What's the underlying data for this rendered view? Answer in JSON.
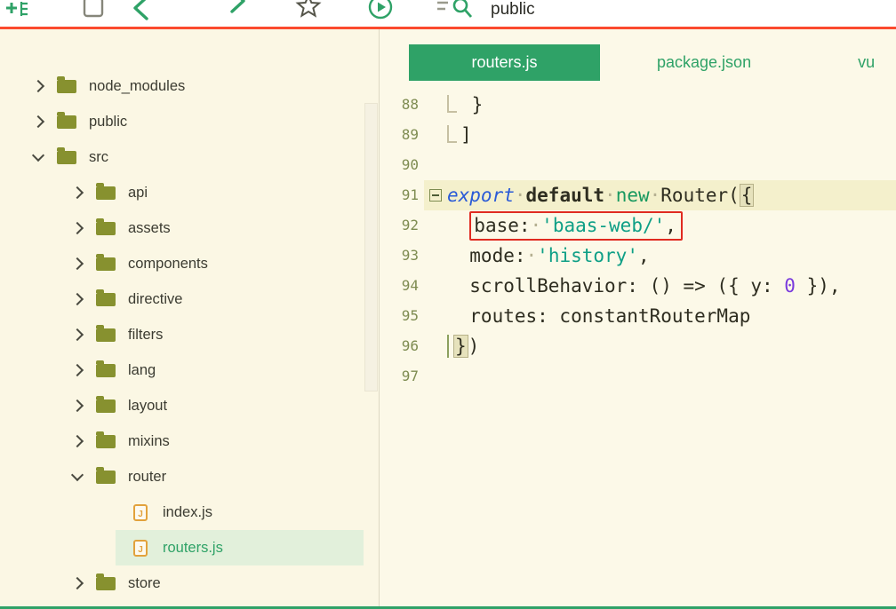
{
  "toolbar": {
    "search_text": "public",
    "icons": [
      "new-file",
      "window",
      "back",
      "forward",
      "star",
      "run",
      "search"
    ]
  },
  "sidebar": {
    "items": [
      {
        "label": "node_modules",
        "depth": 0,
        "kind": "folder",
        "expanded": false,
        "selected": false
      },
      {
        "label": "public",
        "depth": 0,
        "kind": "folder",
        "expanded": false,
        "selected": false
      },
      {
        "label": "src",
        "depth": 0,
        "kind": "folder",
        "expanded": true,
        "selected": false
      },
      {
        "label": "api",
        "depth": 1,
        "kind": "folder",
        "expanded": false,
        "selected": false
      },
      {
        "label": "assets",
        "depth": 1,
        "kind": "folder",
        "expanded": false,
        "selected": false
      },
      {
        "label": "components",
        "depth": 1,
        "kind": "folder",
        "expanded": false,
        "selected": false
      },
      {
        "label": "directive",
        "depth": 1,
        "kind": "folder",
        "expanded": false,
        "selected": false
      },
      {
        "label": "filters",
        "depth": 1,
        "kind": "folder",
        "expanded": false,
        "selected": false
      },
      {
        "label": "lang",
        "depth": 1,
        "kind": "folder",
        "expanded": false,
        "selected": false
      },
      {
        "label": "layout",
        "depth": 1,
        "kind": "folder",
        "expanded": false,
        "selected": false
      },
      {
        "label": "mixins",
        "depth": 1,
        "kind": "folder",
        "expanded": false,
        "selected": false
      },
      {
        "label": "router",
        "depth": 1,
        "kind": "folder",
        "expanded": true,
        "selected": false
      },
      {
        "label": "index.js",
        "depth": 2,
        "kind": "file",
        "expanded": false,
        "selected": false
      },
      {
        "label": "routers.js",
        "depth": 2,
        "kind": "file",
        "expanded": false,
        "selected": true
      },
      {
        "label": "store",
        "depth": 1,
        "kind": "folder",
        "expanded": false,
        "selected": false
      }
    ]
  },
  "editor": {
    "tabs": [
      {
        "label": "routers.js",
        "active": true
      },
      {
        "label": "package.json",
        "active": false
      },
      {
        "label": "vu",
        "active": false
      }
    ],
    "code_lines": [
      {
        "no": "88",
        "highlight": false,
        "fold": "",
        "tokens": [
          {
            "c": "guide",
            "t": ""
          },
          {
            "c": "plain",
            "t": " }"
          }
        ]
      },
      {
        "no": "89",
        "highlight": false,
        "fold": "",
        "tokens": [
          {
            "c": "guide",
            "t": ""
          },
          {
            "c": "plain",
            "t": "]"
          }
        ]
      },
      {
        "no": "90",
        "highlight": false,
        "fold": "",
        "tokens": []
      },
      {
        "no": "91",
        "highlight": true,
        "fold": "open",
        "tokens": [
          {
            "c": "kw1",
            "t": "export"
          },
          {
            "c": "dot",
            "t": "·"
          },
          {
            "c": "kw2",
            "t": "default"
          },
          {
            "c": "dot",
            "t": "·"
          },
          {
            "c": "kw3",
            "t": "new"
          },
          {
            "c": "dot",
            "t": "·"
          },
          {
            "c": "plain",
            "t": "Router("
          },
          {
            "c": "bracket",
            "t": "{"
          }
        ]
      },
      {
        "no": "92",
        "highlight": false,
        "fold": "",
        "tokens": [
          {
            "c": "plain",
            "t": "  "
          },
          {
            "c": "plain",
            "t": "base:",
            "box": true
          },
          {
            "c": "dot",
            "t": "·",
            "box": true
          },
          {
            "c": "str",
            "t": "'baas-web/'",
            "box": true
          },
          {
            "c": "plain",
            "t": ",",
            "box": true
          }
        ]
      },
      {
        "no": "93",
        "highlight": false,
        "fold": "",
        "tokens": [
          {
            "c": "plain",
            "t": "  mode:"
          },
          {
            "c": "dot",
            "t": "·"
          },
          {
            "c": "str",
            "t": "'history'"
          },
          {
            "c": "plain",
            "t": ","
          }
        ]
      },
      {
        "no": "94",
        "highlight": false,
        "fold": "",
        "tokens": [
          {
            "c": "plain",
            "t": "  scrollBehavior: () => ({ y: "
          },
          {
            "c": "num",
            "t": "0"
          },
          {
            "c": "plain",
            "t": " }),"
          }
        ]
      },
      {
        "no": "95",
        "highlight": false,
        "fold": "",
        "tokens": [
          {
            "c": "plain",
            "t": "  routes: constantRouterMap"
          }
        ]
      },
      {
        "no": "96",
        "highlight": false,
        "fold": "",
        "tokens": [
          {
            "c": "guidev",
            "t": ""
          },
          {
            "c": "bracket",
            "t": "}"
          },
          {
            "c": "plain",
            "t": ")"
          }
        ]
      },
      {
        "no": "97",
        "highlight": false,
        "fold": "",
        "tokens": []
      }
    ]
  },
  "colors": {
    "accent_green": "#2fa267",
    "annotation_red": "#e02b20",
    "top_line_red": "#fb4a2e",
    "selection_green": "#e2f0db",
    "line_highlight": "#f4f0cc",
    "string_teal": "#0e9f86",
    "keyword_blue": "#2b5bd7",
    "number_purple": "#7a3bdd"
  }
}
